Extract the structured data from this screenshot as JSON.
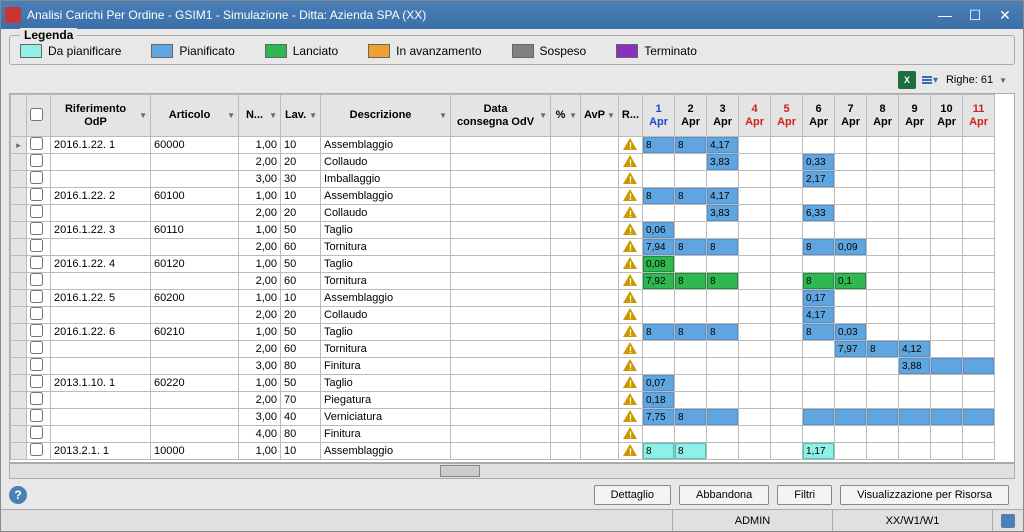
{
  "window": {
    "title": "Analisi Carichi Per Ordine - GSIM1 - Simulazione - Ditta: Azienda SPA (XX)"
  },
  "legend": {
    "title": "Legenda",
    "items": [
      {
        "label": "Da pianificare",
        "color": "#8ff0e8"
      },
      {
        "label": "Pianificato",
        "color": "#5fa6e0"
      },
      {
        "label": "Lanciato",
        "color": "#2fb84f"
      },
      {
        "label": "In avanzamento",
        "color": "#f0a030"
      },
      {
        "label": "Sospeso",
        "color": "#808080"
      },
      {
        "label": "Terminato",
        "color": "#8a2fbf"
      }
    ]
  },
  "toolbar": {
    "rows_label": "Righe: 61"
  },
  "columns": {
    "riferimento": "Riferimento\nOdP",
    "articolo": "Articolo",
    "n": "N...",
    "lav": "Lav.",
    "descrizione": "Descrizione",
    "data_consegna": "Data\nconsegna OdV",
    "pct": "%",
    "avp": "AvP",
    "r": "R..."
  },
  "days": [
    {
      "d": "1",
      "m": "Apr",
      "cls": "first"
    },
    {
      "d": "2",
      "m": "Apr",
      "cls": ""
    },
    {
      "d": "3",
      "m": "Apr",
      "cls": ""
    },
    {
      "d": "4",
      "m": "Apr",
      "cls": "weekend"
    },
    {
      "d": "5",
      "m": "Apr",
      "cls": "weekend"
    },
    {
      "d": "6",
      "m": "Apr",
      "cls": ""
    },
    {
      "d": "7",
      "m": "Apr",
      "cls": ""
    },
    {
      "d": "8",
      "m": "Apr",
      "cls": ""
    },
    {
      "d": "9",
      "m": "Apr",
      "cls": ""
    },
    {
      "d": "10",
      "m": "Apr",
      "cls": ""
    },
    {
      "d": "11",
      "m": "Apr",
      "cls": "weekend"
    }
  ],
  "rows": [
    {
      "sel": "▸",
      "rif": "2016.1.22. 1",
      "art": "60000",
      "n": "1,00",
      "lav": "10",
      "desc": "Assemblaggio",
      "cells": {
        "0": {
          "v": "8",
          "c": "plan"
        },
        "1": {
          "v": "8",
          "c": "plan"
        },
        "2": {
          "v": "4,17",
          "c": "plan"
        }
      }
    },
    {
      "rif": "",
      "art": "",
      "n": "2,00",
      "lav": "20",
      "desc": "Collaudo",
      "cells": {
        "2": {
          "v": "3,83",
          "c": "plan"
        },
        "5": {
          "v": "0,33",
          "c": "plan"
        }
      }
    },
    {
      "rif": "",
      "art": "",
      "n": "3,00",
      "lav": "30",
      "desc": "Imballaggio",
      "cells": {
        "5": {
          "v": "2,17",
          "c": "plan"
        }
      }
    },
    {
      "rif": "2016.1.22. 2",
      "art": "60100",
      "n": "1,00",
      "lav": "10",
      "desc": "Assemblaggio",
      "cells": {
        "0": {
          "v": "8",
          "c": "plan"
        },
        "1": {
          "v": "8",
          "c": "plan"
        },
        "2": {
          "v": "4,17",
          "c": "plan"
        }
      }
    },
    {
      "rif": "",
      "art": "",
      "n": "2,00",
      "lav": "20",
      "desc": "Collaudo",
      "cells": {
        "2": {
          "v": "3,83",
          "c": "plan"
        },
        "5": {
          "v": "6,33",
          "c": "plan"
        }
      }
    },
    {
      "rif": "2016.1.22. 3",
      "art": "60110",
      "n": "1,00",
      "lav": "50",
      "desc": "Taglio",
      "cells": {
        "0": {
          "v": "0,06",
          "c": "plan"
        }
      }
    },
    {
      "rif": "",
      "art": "",
      "n": "2,00",
      "lav": "60",
      "desc": "Tornitura",
      "cells": {
        "0": {
          "v": "7,94",
          "c": "plan"
        },
        "1": {
          "v": "8",
          "c": "plan"
        },
        "2": {
          "v": "8",
          "c": "plan"
        },
        "5": {
          "v": "8",
          "c": "plan"
        },
        "6": {
          "v": "0,09",
          "c": "plan"
        }
      }
    },
    {
      "rif": "2016.1.22. 4",
      "art": "60120",
      "n": "1,00",
      "lav": "50",
      "desc": "Taglio",
      "cells": {
        "0": {
          "v": "0,08",
          "c": "launch"
        }
      }
    },
    {
      "rif": "",
      "art": "",
      "n": "2,00",
      "lav": "60",
      "desc": "Tornitura",
      "cells": {
        "0": {
          "v": "7,92",
          "c": "launch"
        },
        "1": {
          "v": "8",
          "c": "launch"
        },
        "2": {
          "v": "8",
          "c": "launch"
        },
        "5": {
          "v": "8",
          "c": "launch"
        },
        "6": {
          "v": "0,1",
          "c": "launch"
        }
      }
    },
    {
      "rif": "2016.1.22. 5",
      "art": "60200",
      "n": "1,00",
      "lav": "10",
      "desc": "Assemblaggio",
      "cells": {
        "5": {
          "v": "0,17",
          "c": "plan"
        }
      }
    },
    {
      "rif": "",
      "art": "",
      "n": "2,00",
      "lav": "20",
      "desc": "Collaudo",
      "cells": {
        "5": {
          "v": "4,17",
          "c": "plan"
        }
      }
    },
    {
      "rif": "2016.1.22. 6",
      "art": "60210",
      "n": "1,00",
      "lav": "50",
      "desc": "Taglio",
      "cells": {
        "0": {
          "v": "8",
          "c": "plan"
        },
        "1": {
          "v": "8",
          "c": "plan"
        },
        "2": {
          "v": "8",
          "c": "plan"
        },
        "5": {
          "v": "8",
          "c": "plan"
        },
        "6": {
          "v": "0,03",
          "c": "plan"
        }
      }
    },
    {
      "rif": "",
      "art": "",
      "n": "2,00",
      "lav": "60",
      "desc": "Tornitura",
      "cells": {
        "6": {
          "v": "7,97",
          "c": "plan"
        },
        "7": {
          "v": "8",
          "c": "plan"
        },
        "8": {
          "v": "4,12",
          "c": "plan"
        }
      }
    },
    {
      "rif": "",
      "art": "",
      "n": "3,00",
      "lav": "80",
      "desc": "Finitura",
      "cells": {
        "8": {
          "v": "3,88",
          "c": "plan"
        },
        "9": {
          "v": "",
          "c": "plan"
        },
        "10": {
          "v": "",
          "c": "plan"
        }
      }
    },
    {
      "rif": "2013.1.10. 1",
      "art": "60220",
      "n": "1,00",
      "lav": "50",
      "desc": "Taglio",
      "cells": {
        "0": {
          "v": "0,07",
          "c": "plan"
        }
      }
    },
    {
      "rif": "",
      "art": "",
      "n": "2,00",
      "lav": "70",
      "desc": "Piegatura",
      "cells": {
        "0": {
          "v": "0,18",
          "c": "plan"
        }
      }
    },
    {
      "rif": "",
      "art": "",
      "n": "3,00",
      "lav": "40",
      "desc": "Verniciatura",
      "cells": {
        "0": {
          "v": "7,75",
          "c": "plan"
        },
        "1": {
          "v": "8",
          "c": "plan"
        },
        "2": {
          "v": "",
          "c": "plan"
        },
        "5": {
          "v": "",
          "c": "plan"
        },
        "6": {
          "v": "",
          "c": "plan"
        },
        "7": {
          "v": "",
          "c": "plan"
        },
        "8": {
          "v": "",
          "c": "plan"
        },
        "9": {
          "v": "",
          "c": "plan"
        },
        "10": {
          "v": "",
          "c": "plan"
        }
      }
    },
    {
      "rif": "",
      "art": "",
      "n": "4,00",
      "lav": "80",
      "desc": "Finitura",
      "cells": {}
    },
    {
      "rif": "2013.2.1. 1",
      "art": "10000",
      "n": "1,00",
      "lav": "10",
      "desc": "Assemblaggio",
      "cells": {
        "0": {
          "v": "8",
          "c": "todo"
        },
        "1": {
          "v": "8",
          "c": "todo"
        },
        "5": {
          "v": "1,17",
          "c": "todo"
        }
      }
    }
  ],
  "buttons": {
    "dettaglio": "Dettaglio",
    "abbandona": "Abbandona",
    "filtri": "Filtri",
    "vis_risorsa": "Visualizzazione per Risorsa"
  },
  "status": {
    "admin": "ADMIN",
    "path": "XX/W1/W1"
  }
}
